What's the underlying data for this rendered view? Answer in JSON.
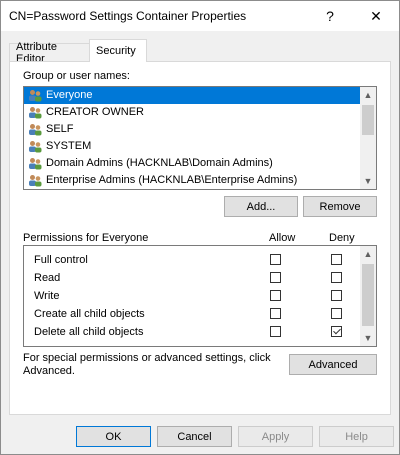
{
  "window": {
    "title": "CN=Password Settings Container Properties",
    "help_glyph": "?",
    "close_glyph": "✕"
  },
  "tabs": [
    {
      "label": "Attribute Editor",
      "active": false
    },
    {
      "label": "Security",
      "active": true
    }
  ],
  "security": {
    "group_label": "Group or user names:",
    "users": [
      {
        "name": "Everyone",
        "selected": true
      },
      {
        "name": "CREATOR OWNER",
        "selected": false
      },
      {
        "name": "SELF",
        "selected": false
      },
      {
        "name": "SYSTEM",
        "selected": false
      },
      {
        "name": "Domain Admins (HACKNLAB\\Domain Admins)",
        "selected": false
      },
      {
        "name": "Enterprise Admins (HACKNLAB\\Enterprise Admins)",
        "selected": false
      }
    ],
    "add_label": "Add...",
    "remove_label": "Remove",
    "permissions_label": "Permissions for Everyone",
    "allow_header": "Allow",
    "deny_header": "Deny",
    "permissions": [
      {
        "name": "Full control",
        "allow": false,
        "deny": false
      },
      {
        "name": "Read",
        "allow": false,
        "deny": false
      },
      {
        "name": "Write",
        "allow": false,
        "deny": false
      },
      {
        "name": "Create all child objects",
        "allow": false,
        "deny": false
      },
      {
        "name": "Delete all child objects",
        "allow": false,
        "deny": true
      }
    ],
    "advanced_text": "For special permissions or advanced settings, click Advanced.",
    "advanced_label": "Advanced"
  },
  "footer": {
    "ok_label": "OK",
    "cancel_label": "Cancel",
    "apply_label": "Apply",
    "help_label": "Help"
  }
}
